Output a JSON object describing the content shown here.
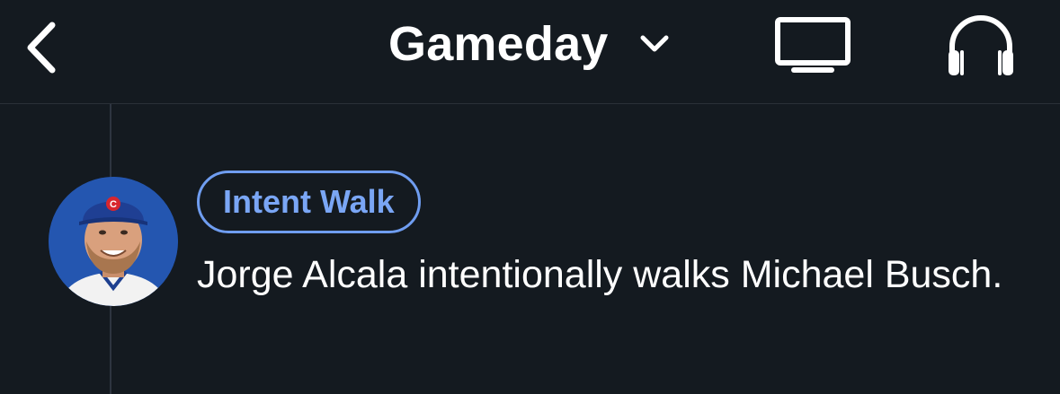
{
  "header": {
    "title": "Gameday",
    "back_icon": "chevron-left-icon",
    "dropdown_icon": "chevron-down-icon",
    "tv_icon": "tv-icon",
    "audio_icon": "headphones-icon"
  },
  "event": {
    "badge_label": "Intent Walk",
    "description": "Jorge Alcala intentionally walks Michael Busch.",
    "avatar_icon": "player-headshot"
  },
  "colors": {
    "background": "#141a20",
    "badge_accent": "#7aa6f5",
    "text": "#ffffff"
  }
}
